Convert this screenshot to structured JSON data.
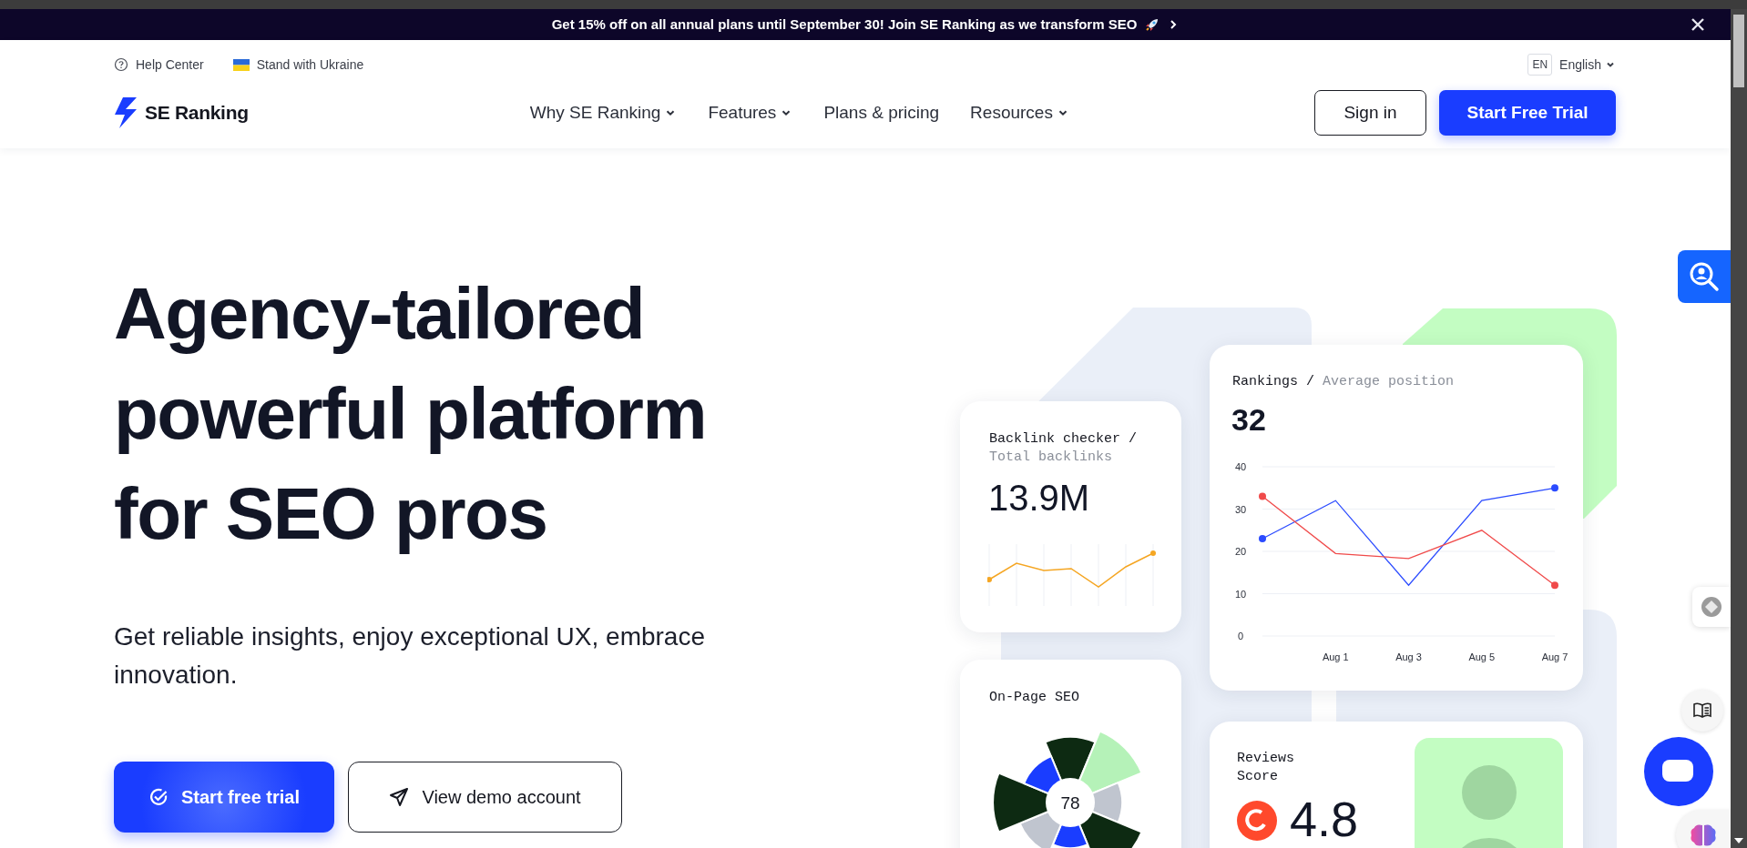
{
  "announcement": {
    "text": "Get 15% off on all annual plans until September 30! Join SE Ranking as we transform SEO"
  },
  "utility_links": [
    {
      "label": "Help Center",
      "kind": "help"
    },
    {
      "label": "Stand with Ukraine",
      "kind": "flag"
    }
  ],
  "language": {
    "code": "EN",
    "label": "English"
  },
  "logo": {
    "text": "SE Ranking"
  },
  "nav": [
    {
      "label": "Why SE Ranking",
      "dropdown": true
    },
    {
      "label": "Features",
      "dropdown": true
    },
    {
      "label": "Plans & pricing",
      "dropdown": false
    },
    {
      "label": "Resources",
      "dropdown": true
    }
  ],
  "header_buttons": [
    {
      "label": "Sign in",
      "kind": "outline"
    },
    {
      "label": "Start Free Trial",
      "kind": "primary"
    }
  ],
  "hero": {
    "title_lines": [
      "Agency-tailored",
      "powerful platform",
      "for SEO pros"
    ],
    "subtitle": "Get reliable insights, enjoy exceptional UX, embrace innovation.",
    "buttons": [
      {
        "label": "Start free trial",
        "kind": "primary"
      },
      {
        "label": "View demo account",
        "kind": "outline"
      }
    ]
  },
  "backlink_card": {
    "title": "Backlink checker /",
    "subtitle": "Total backlinks",
    "value": "13.9M"
  },
  "rankings_card": {
    "title": "Rankings /",
    "subtitle": "Average position",
    "value": "32",
    "chart_data": {
      "type": "line",
      "categories": [
        null,
        "Aug 1",
        "Aug 3",
        "Aug 5",
        "Aug 7"
      ],
      "series": [
        {
          "color": "#2b4bff",
          "values": [
            23,
            32,
            12,
            32,
            35
          ]
        },
        {
          "color": "#f04a4a",
          "values": [
            33,
            19.5,
            18.3,
            25,
            12
          ]
        }
      ],
      "ylim": [
        0,
        40
      ],
      "yticks": [
        0,
        10,
        20,
        30,
        40
      ],
      "grid": true
    }
  },
  "onpage_card": {
    "title": "On-Page SEO",
    "score": "78"
  },
  "reviews_card": {
    "title": "Reviews Score",
    "score": "4.8"
  }
}
